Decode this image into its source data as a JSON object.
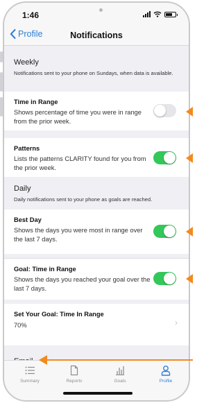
{
  "status": {
    "time": "1:46"
  },
  "nav": {
    "back_label": "Profile",
    "title": "Notifications"
  },
  "weekly": {
    "title": "Weekly",
    "subtitle": "Notifications sent to your phone on Sundays, when data is available."
  },
  "daily": {
    "title": "Daily",
    "subtitle": "Daily notifications sent to your phone as goals are reached."
  },
  "settings": [
    {
      "title": "Time in Range",
      "desc": "Shows percentage of time you were in range from the prior week.",
      "enabled": false
    },
    {
      "title": "Patterns",
      "desc": "Lists the patterns CLARITY found for you from the prior week.",
      "enabled": true
    },
    {
      "title": "Best Day",
      "desc": "Shows the days you were most in range over the last 7 days.",
      "enabled": true
    },
    {
      "title": "Goal: Time in Range",
      "desc": "Shows the days you reached your goal over the last 7 days.",
      "enabled": true
    }
  ],
  "goal_setting": {
    "title": "Set Your Goal: Time In Range",
    "value": "70%"
  },
  "email": {
    "title": "Email"
  },
  "tabs": [
    {
      "label": "Summary",
      "icon": "list-icon",
      "active": false
    },
    {
      "label": "Reports",
      "icon": "document-icon",
      "active": false
    },
    {
      "label": "Goals",
      "icon": "bar-chart-icon",
      "active": false
    },
    {
      "label": "Profile",
      "icon": "person-icon",
      "active": true
    }
  ],
  "colors": {
    "accent": "#2f7fd6",
    "toggle_on": "#34c759",
    "annotation_arrow": "#f28a1d"
  }
}
